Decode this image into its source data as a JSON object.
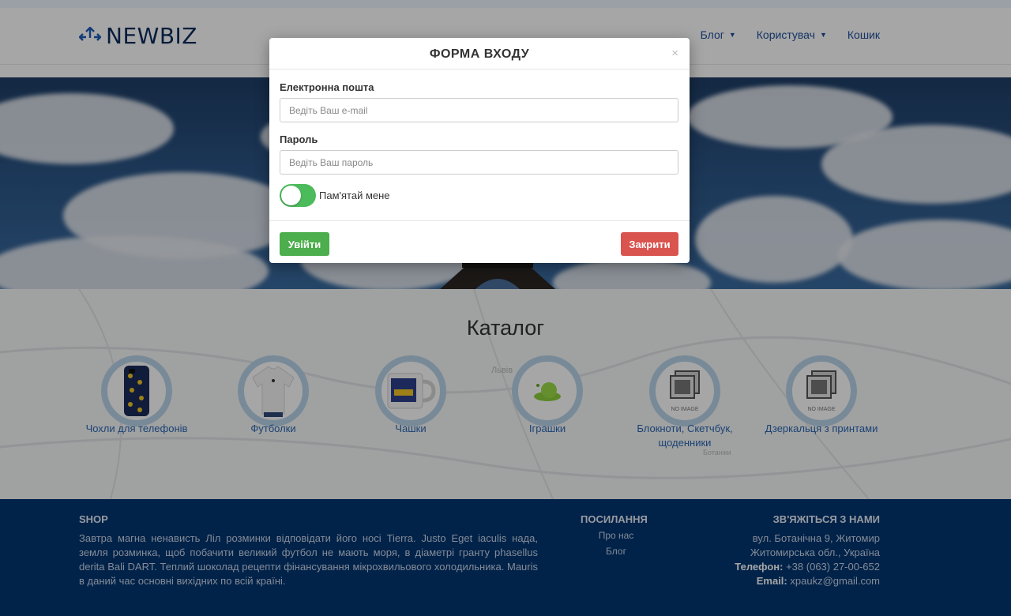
{
  "header": {
    "logo_text": "NEWBIZ",
    "nav": [
      {
        "label": "Блог",
        "has_dropdown": true
      },
      {
        "label": "Користувач",
        "has_dropdown": true
      },
      {
        "label": "Кошик",
        "has_dropdown": false
      }
    ]
  },
  "catalog": {
    "title": "Каталог",
    "map_labels": [
      "Львів",
      "Ботаніки"
    ],
    "items": [
      {
        "label": "Чохли для телефонів",
        "image": "phone-case"
      },
      {
        "label": "Футболки",
        "image": "tshirt"
      },
      {
        "label": "Чашки",
        "image": "mug"
      },
      {
        "label": "Іграшки",
        "image": "toy"
      },
      {
        "label": "Блокноти, Скетчбук, щоденники",
        "image": "no-image",
        "noimage_text": "NO IMAGE"
      },
      {
        "label": "Дзеркальця з принтами",
        "image": "no-image",
        "noimage_text": "NO IMAGE"
      }
    ]
  },
  "footer": {
    "shop": {
      "title": "SHOP",
      "text": "Завтра магна ненависть Ліл розминки відповідати його носі Tierra. Justo Eget iaculis нада, земля розминка, щоб побачити великий футбол не мають моря, в діаметрі гранту phasellus derita Balі DART. Теплий шоколад рецепти фінансування мікрохвильового холодильника. Mauris в даний час основні вихідних по всій країні."
    },
    "links": {
      "title": "ПОСИЛАННЯ",
      "items": [
        "Про нас",
        "Блог"
      ]
    },
    "contact": {
      "title": "ЗВ'ЯЖІТЬСЯ З НАМИ",
      "address1": "вул. Ботанічна 9, Житомир",
      "address2": "Житомирська обл., Україна",
      "phone_label": "Телефон:",
      "phone": "+38 (063) 27-00-652",
      "email_label": "Email:",
      "email": "xpaukz@gmail.com"
    }
  },
  "modal": {
    "title": "ФОРМА ВХОДУ",
    "close_symbol": "×",
    "email_label": "Електронна пошта",
    "email_placeholder": "Ведіть Ваш e-mail",
    "email_value": "",
    "password_label": "Пароль",
    "password_placeholder": "Ведіть Ваш пароль",
    "password_value": "",
    "remember_label": "Пам'ятай мене",
    "remember_checked": true,
    "login_button": "Увійти",
    "close_button": "Закрити",
    "colors": {
      "success": "#4cae4c",
      "danger": "#d9534f",
      "toggle_on": "#4cbb5b"
    }
  }
}
